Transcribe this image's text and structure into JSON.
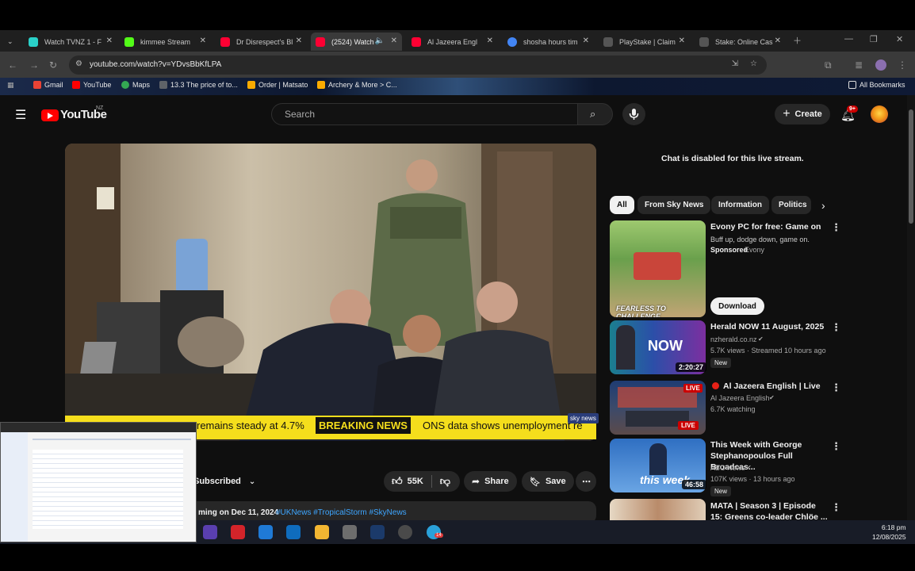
{
  "tabs": [
    {
      "label": "Watch TVNZ 1 - F",
      "color": "#2ad1c9"
    },
    {
      "label": "kimmee Stream",
      "color": "#53fc18"
    },
    {
      "label": "Dr Disrespect's Bl",
      "color": "#ff0033"
    },
    {
      "label": "(2524) Watch",
      "color": "#ff0033"
    },
    {
      "label": "Al Jazeera Engl",
      "color": "#ff0033"
    },
    {
      "label": "shosha hours tim",
      "color": "#4285f4"
    },
    {
      "label": "PlayStake | Claim",
      "color": "#cccccc"
    },
    {
      "label": "Stake: Online Cas",
      "color": "#cccccc"
    }
  ],
  "address": {
    "url": "youtube.com/watch?v=YDvsBbKfLPA"
  },
  "bookmarks": [
    {
      "label": "Gmail",
      "color": "#ea4335"
    },
    {
      "label": "YouTube",
      "color": "#ff0000"
    },
    {
      "label": "Maps",
      "color": "#34a853"
    },
    {
      "label": "13.3 The price of to...",
      "color": "#5f6368"
    },
    {
      "label": "Order | Matsato",
      "color": "#f9ab00"
    },
    {
      "label": "Archery & More > C...",
      "color": "#f9ab00"
    }
  ],
  "bookmarks_all": "All Bookmarks",
  "youtube": {
    "logo_text": "YouTube",
    "region": "NZ",
    "search_placeholder": "Search",
    "create_label": "Create",
    "notif_count": "9+"
  },
  "video": {
    "ticker_left": "remains steady at 4.7%",
    "breaking_label": "BREAKING NEWS",
    "ticker_right": "ONS data shows unemployment re",
    "sky_logo": "sky news",
    "subscribed_label": "Subscribed",
    "likes": "55K",
    "share_label": "Share",
    "save_label": "Save",
    "description": "ming on Dec 11, 2024",
    "tags": "#UKNews #TropicalStorm #SkyNews"
  },
  "sidebar": {
    "chat_disabled": "Chat is disabled for this live stream.",
    "chips": [
      "All",
      "From Sky News",
      "Information",
      "Politics"
    ],
    "items": [
      {
        "title": "Evony PC for free: Game on",
        "line2": "Buff up, dodge down, game on.",
        "sponsored": "Sponsored",
        "channel": "Evony",
        "cta": "Download",
        "thumb_text": "FEARLESS TO CHALLENGE"
      },
      {
        "title": "Herald NOW 11 August, 2025",
        "channel": "nzherald.co.nz",
        "stats": "5.7K views · Streamed 10 hours ago",
        "badge": "New",
        "duration": "2:20:27",
        "thumb_text": "NOW"
      },
      {
        "title": "Al Jazeera English | Live",
        "channel": "Al Jazeera English",
        "stats": "6.7K watching",
        "live_badge": "LIVE",
        "thumb_text": "LIVE"
      },
      {
        "title": "This Week with George Stephanopoulos Full Broadcas...",
        "channel": "ABC News",
        "stats": "107K views · 13 hours ago",
        "badge": "New",
        "duration": "46:58",
        "thumb_text": "this week"
      },
      {
        "title": "MATA | Season 3 | Episode 15: Greens co-leader Chlöe ..."
      }
    ]
  },
  "taskbar": {
    "time": "6:18 pm",
    "date": "12/08/2025",
    "steam_badge": "14"
  }
}
